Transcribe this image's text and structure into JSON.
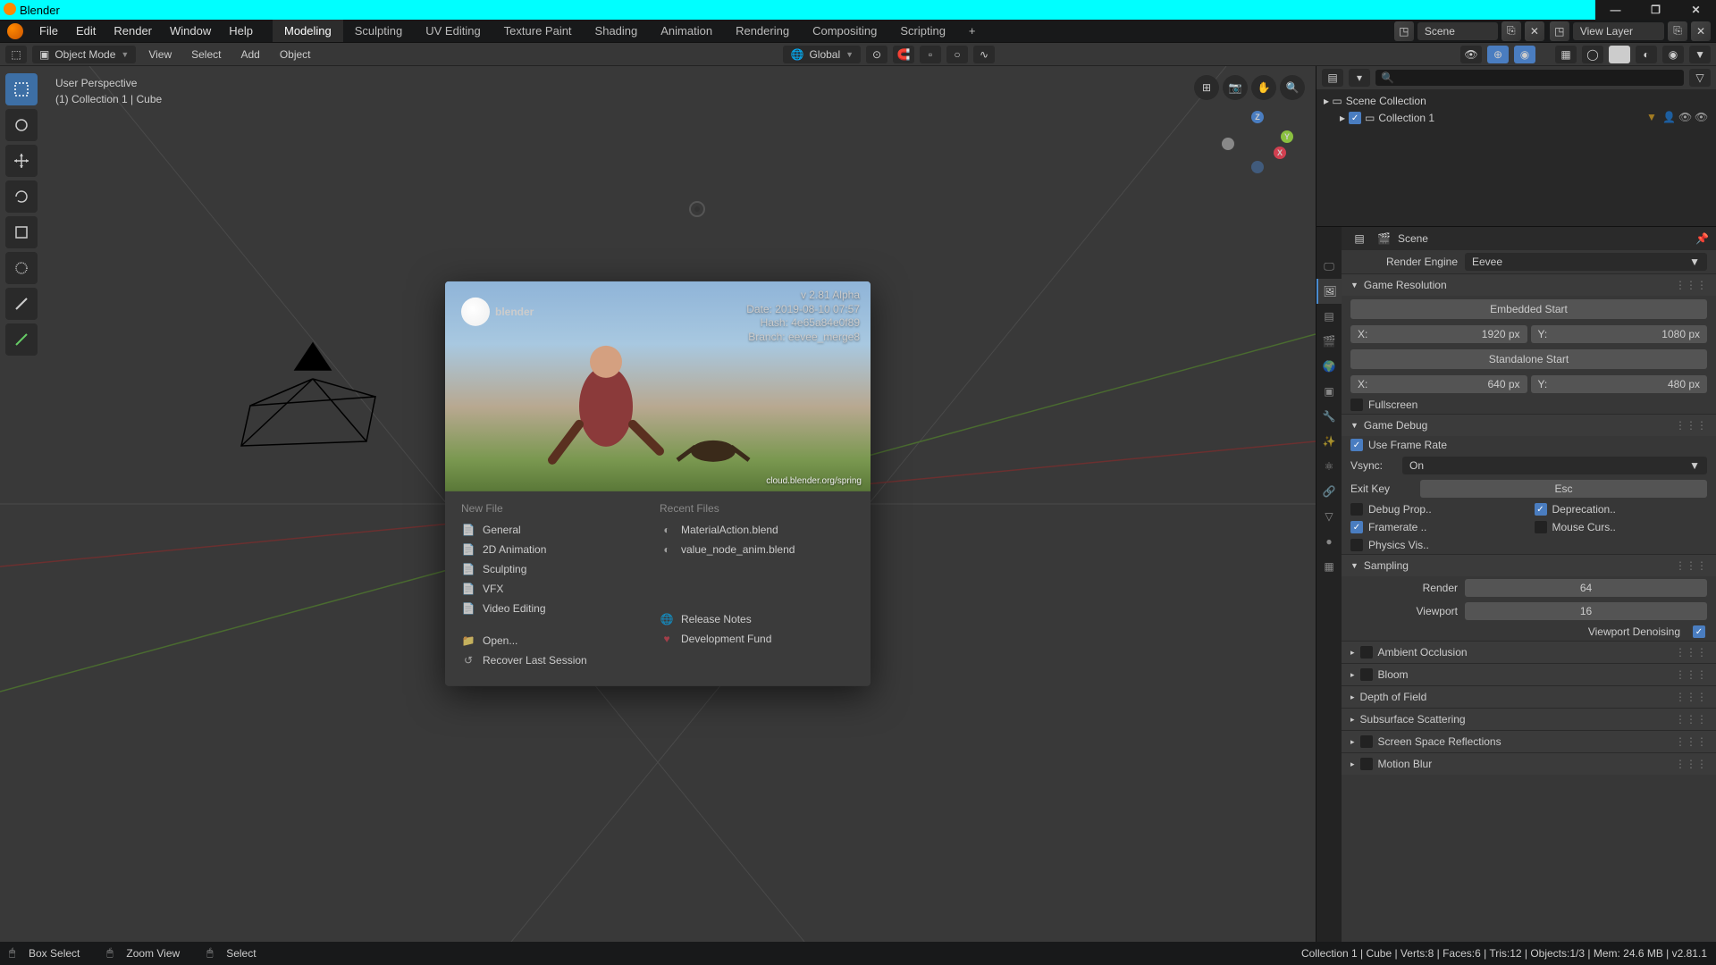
{
  "window": {
    "title": "Blender"
  },
  "menubar": {
    "items": [
      "File",
      "Edit",
      "Render",
      "Window",
      "Help"
    ],
    "workspaces": [
      "Modeling",
      "Sculpting",
      "UV Editing",
      "Texture Paint",
      "Shading",
      "Animation",
      "Rendering",
      "Compositing",
      "Scripting"
    ],
    "active_workspace": "Modeling",
    "scene_label": "Scene",
    "viewlayer_label": "View Layer"
  },
  "topbar": {
    "mode": "Object Mode",
    "menus": [
      "View",
      "Select",
      "Add",
      "Object"
    ],
    "orientation": "Global"
  },
  "viewport": {
    "overlay_line1": "User Perspective",
    "overlay_line2": "(1) Collection 1 | Cube"
  },
  "splash": {
    "logo": "blender",
    "meta_line1": "v 2.81 Alpha",
    "meta_line2": "Date: 2019-08-10 07:57",
    "meta_line3": "Hash: 4e65a84e0f89",
    "meta_line4": "Branch: eevee_merge8",
    "credit": "cloud.blender.org/spring",
    "newfile_hdr": "New File",
    "newfile_items": [
      "General",
      "2D Animation",
      "Sculpting",
      "VFX",
      "Video Editing"
    ],
    "open": "Open...",
    "recover": "Recover Last Session",
    "recent_hdr": "Recent Files",
    "recent_items": [
      "MaterialAction.blend",
      "value_node_anim.blend"
    ],
    "release_notes": "Release Notes",
    "dev_fund": "Development Fund"
  },
  "outliner": {
    "root": "Scene Collection",
    "col1": "Collection 1"
  },
  "properties": {
    "breadcrumb": "Scene",
    "render_engine_label": "Render Engine",
    "render_engine": "Eevee",
    "panels": {
      "game_resolution": {
        "title": "Game Resolution",
        "embedded_start": "Embedded Start",
        "x1_label": "X:",
        "x1_val": "1920 px",
        "y1_label": "Y:",
        "y1_val": "1080 px",
        "standalone_start": "Standalone Start",
        "x2_label": "X:",
        "x2_val": "640 px",
        "y2_label": "Y:",
        "y2_val": "480 px",
        "fullscreen": "Fullscreen"
      },
      "game_debug": {
        "title": "Game Debug",
        "use_frame_rate": "Use Frame Rate",
        "vsync_label": "Vsync:",
        "vsync_val": "On",
        "exit_key": "Exit Key",
        "exit_key_val": "Esc",
        "debug_prop": "Debug Prop..",
        "deprecation": "Deprecation..",
        "framerate": "Framerate ..",
        "mouse_curs": "Mouse Curs..",
        "physics": "Physics Vis.."
      },
      "sampling": {
        "title": "Sampling",
        "render_label": "Render",
        "render_val": "64",
        "viewport_label": "Viewport",
        "viewport_val": "16",
        "denoising": "Viewport Denoising"
      },
      "collapsed": [
        "Ambient Occlusion",
        "Bloom",
        "Depth of Field",
        "Subsurface Scattering",
        "Screen Space Reflections",
        "Motion Blur"
      ]
    }
  },
  "statusbar": {
    "left1": "Box Select",
    "left2": "Zoom View",
    "left3": "Select",
    "right": "Collection 1 | Cube | Verts:8 | Faces:6 | Tris:12 | Objects:1/3 | Mem: 24.6 MB | v2.81.1"
  }
}
